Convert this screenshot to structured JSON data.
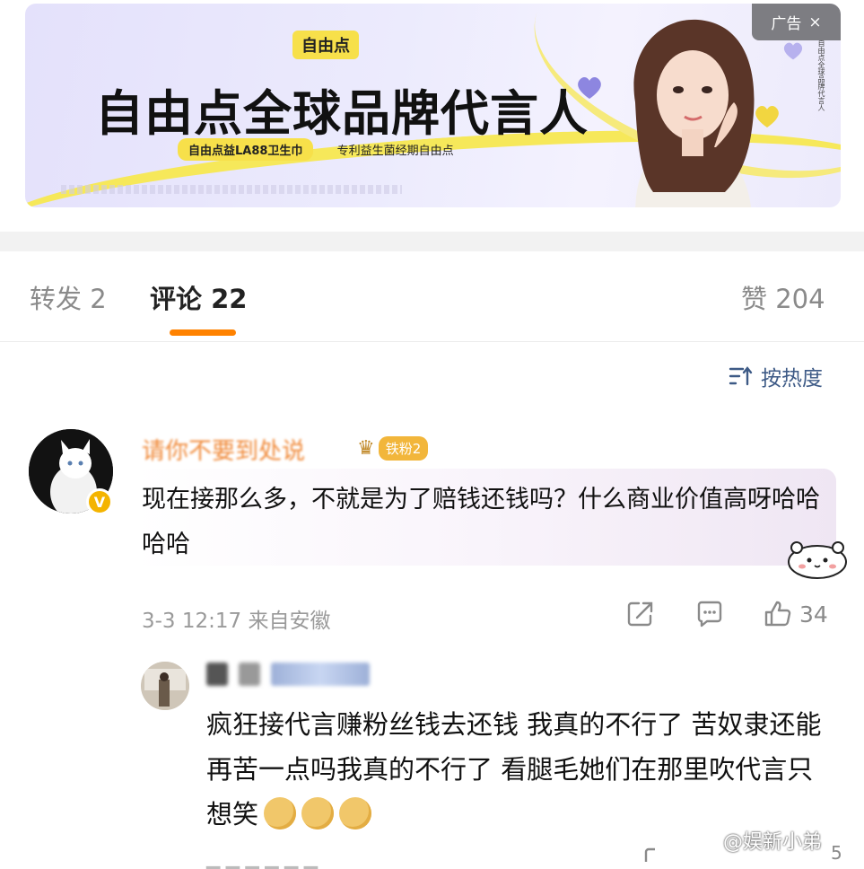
{
  "ad": {
    "logo": "自由点",
    "slogan": "自由点全球品牌代言人",
    "product_pill": "自由点益LA88卫生巾",
    "tagline": "专利益生菌经期自由点",
    "badge_label": "广告",
    "badge_close": "×"
  },
  "tabs": {
    "repost": "转发 2",
    "comment": "评论 22",
    "like": "赞 204"
  },
  "sort": {
    "label": "按热度"
  },
  "comment1": {
    "username": "请你不要到处说",
    "fan_level": "铁粉2",
    "text": "现在接那么多，不就是为了赔钱还钱吗？什么商业价值高呀哈哈哈哈",
    "meta": "3-3 12:17  来自安徽",
    "likes": "34"
  },
  "reply1": {
    "text": "疯狂接代言赚粉丝钱去还钱  我真的不行了  苦奴隶还能再苦一点吗我真的不行了  看腿毛她们在那里吹代言只想笑",
    "likes": "5"
  },
  "watermark": "@娱新小弟",
  "colors": {
    "accent": "#ff8200",
    "username": "#f08a3a",
    "sort": "#3d5a86",
    "ad_yellow": "#f7e04a"
  },
  "icons": [
    "share-icon",
    "comment-icon",
    "like-icon",
    "sort-icon",
    "close-icon",
    "verified-icon",
    "crown-icon"
  ]
}
